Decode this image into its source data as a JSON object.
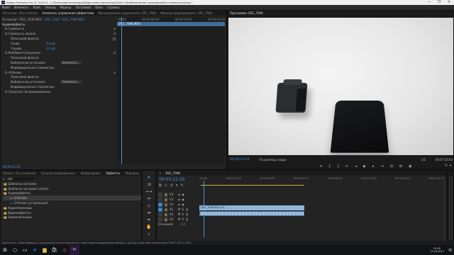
{
  "window": {
    "title": "Adobe Premiere Pro CC 2015.4 - C:\\Пользователи\\Андрей\\Документы\\каналы\\GoPro Life\\обновление прошивки\\Без названия.prproj *",
    "app_badge": "Pr",
    "minimize": "—",
    "maximize": "❐",
    "close": "✕"
  },
  "menu": [
    "Файл",
    "Изменить",
    "Клип",
    "Эпизод",
    "Маркер",
    "Заголовок",
    "Окно",
    "Справка"
  ],
  "effect_controls": {
    "tabs": [
      "Источник: (без клипов)",
      "Элементы управления эффектами",
      "Микширование аудиоклипа: DSC_7046",
      "Микшер аудиодорожек: DSC_7046"
    ],
    "active_tab": 1,
    "master_label": "Основной * DSC_7046.MOV",
    "clip_label": "DSC_7046 * DSC_7046.MOV",
    "section": "Аудиоэффекты",
    "mini_timeline": {
      "t0": ":00:00",
      "t1": "00:00:08:00",
      "t2": "00:00:16:00",
      "t3": "00:00:24:00",
      "clip_name": "DSC_7046.MOV"
    },
    "rows": [
      {
        "label": "fx  Громкость",
        "value": ""
      },
      {
        "label": "fx  Громкость канала",
        "value": ""
      },
      {
        "label": "Полосовой фильтр",
        "value": ""
      },
      {
        "label": "Слева",
        "value": "0,0 дБ"
      },
      {
        "label": "Справа",
        "value": "0,0 дБ"
      },
      {
        "label": "fx  Multiband Compressor",
        "value": ""
      },
      {
        "label": "Полосовой фильтр",
        "value": ""
      },
      {
        "label": "Выборочная установка",
        "value": "Изменить..."
      },
      {
        "label": "Индивидуальные параметры",
        "value": ""
      },
      {
        "label": "fx  Отбелие",
        "value": ""
      },
      {
        "label": "Полосовой фильтр",
        "value": ""
      },
      {
        "label": "Выборочная установка",
        "value": "Изменить..."
      },
      {
        "label": "Индивидуальные параметры",
        "value": ""
      },
      {
        "label": "fx  Средство панорамирования",
        "value": ""
      }
    ],
    "timecode": "00:00:22:29"
  },
  "program": {
    "tab": "Программа: DSC_7046",
    "timecode": "00:00:22:29",
    "fit": "По размеру кадра",
    "quality": "1/2",
    "duration": "00:07:20:03"
  },
  "project": {
    "tabs": [
      "Проект: Без названия",
      "Браузер медиаданных",
      "Информация",
      "Эффекты",
      "Маркеры"
    ],
    "active_tab": 3,
    "search": "deb",
    "tree": [
      {
        "label": "Шаблоны настроек",
        "indent": 0
      },
      {
        "label": "Шаблоны настроек Lumetri",
        "indent": 0
      },
      {
        "label": "Аудиоэффекты",
        "indent": 0
      },
      {
        "label": "Отбелие",
        "indent": 1,
        "selected": true
      },
      {
        "label": "Отбелие (устаревший)",
        "indent": 1
      },
      {
        "label": "Аудиопереходы",
        "indent": 0
      },
      {
        "label": "Видеоэффекты",
        "indent": 0
      },
      {
        "label": "Видеопереходы",
        "indent": 0
      }
    ]
  },
  "timeline": {
    "tab": "DSC_7046",
    "timecode": "00:00:22:29",
    "ruler": [
      ":00:00",
      "00:00:14:23",
      "00:00:29:23",
      "00:00:44:22",
      "00:00:59:22",
      "00:01:14:22",
      "00:01:29:21",
      "00:01:44:21"
    ],
    "tracks": [
      {
        "name": "V3"
      },
      {
        "name": "V2"
      },
      {
        "name": "V1"
      },
      {
        "name": "A1"
      },
      {
        "name": "A2"
      },
      {
        "name": "A3"
      }
    ],
    "master": "Основной",
    "master_value": "0,0",
    "video_clip": "DSC_7046.MOV [V]"
  },
  "status_text": "Щелкните, чтобы выбрать, или щелкните в пустом месте и перетащите выделенную область. Для др. действий используйте SHIFT, ALT и CTRL.",
  "taskbar": {
    "time": "23:05",
    "date": "17.04.2017",
    "icons": [
      "windows-icon",
      "search-icon",
      "task-view-icon",
      "edge-icon",
      "explorer-icon",
      "store-icon",
      "chrome-icon",
      "premiere-icon"
    ]
  },
  "colors": {
    "accent": "#2d6fb0",
    "timecode": "#4c8fd6",
    "playhead": "#4c8fd6",
    "clip_video": "#8fb5d8",
    "clip_audio": "#5e89b4"
  }
}
